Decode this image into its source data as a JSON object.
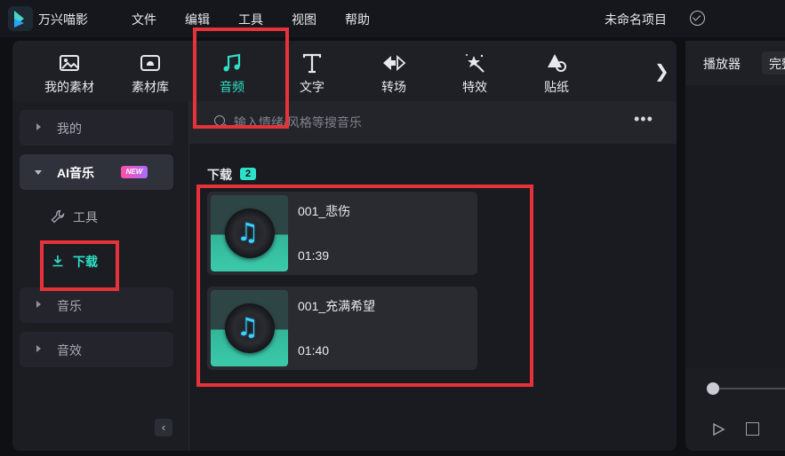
{
  "titlebar": {
    "app_name": "万兴喵影",
    "menu": [
      "文件",
      "编辑",
      "工具",
      "视图",
      "帮助"
    ],
    "project_name": "未命名项目"
  },
  "toolbar": {
    "tabs": [
      {
        "label": "我的素材",
        "icon": "media-icon"
      },
      {
        "label": "素材库",
        "icon": "stock-library-icon"
      },
      {
        "label": "音频",
        "icon": "music-note-icon",
        "active": true
      },
      {
        "label": "文字",
        "icon": "text-icon"
      },
      {
        "label": "转场",
        "icon": "transition-icon"
      },
      {
        "label": "特效",
        "icon": "effects-icon"
      },
      {
        "label": "贴纸",
        "icon": "sticker-icon"
      }
    ],
    "more_glyph": "❯"
  },
  "sidebar": {
    "items": [
      {
        "label": "我的"
      },
      {
        "label": "AI音乐",
        "badge": "NEW",
        "expanded": true
      },
      {
        "label": "音乐"
      },
      {
        "label": "音效"
      }
    ],
    "sub_items": [
      {
        "label": "工具",
        "icon": "wrench-icon"
      },
      {
        "label": "下载",
        "icon": "download-icon",
        "active": true
      }
    ],
    "collapse_glyph": "‹"
  },
  "search": {
    "placeholder": "输入情绪/风格等搜音乐",
    "more_glyph": "•••"
  },
  "downloads": {
    "title": "下载",
    "count": "2",
    "items": [
      {
        "title": "001_悲伤",
        "duration": "01:39"
      },
      {
        "title": "001_充满希望",
        "duration": "01:40"
      }
    ]
  },
  "player": {
    "label": "播放器",
    "quality": "完整"
  },
  "colors": {
    "accent": "#2ee0c7",
    "highlight": "#e8323a",
    "note": "#3fd0ff"
  }
}
